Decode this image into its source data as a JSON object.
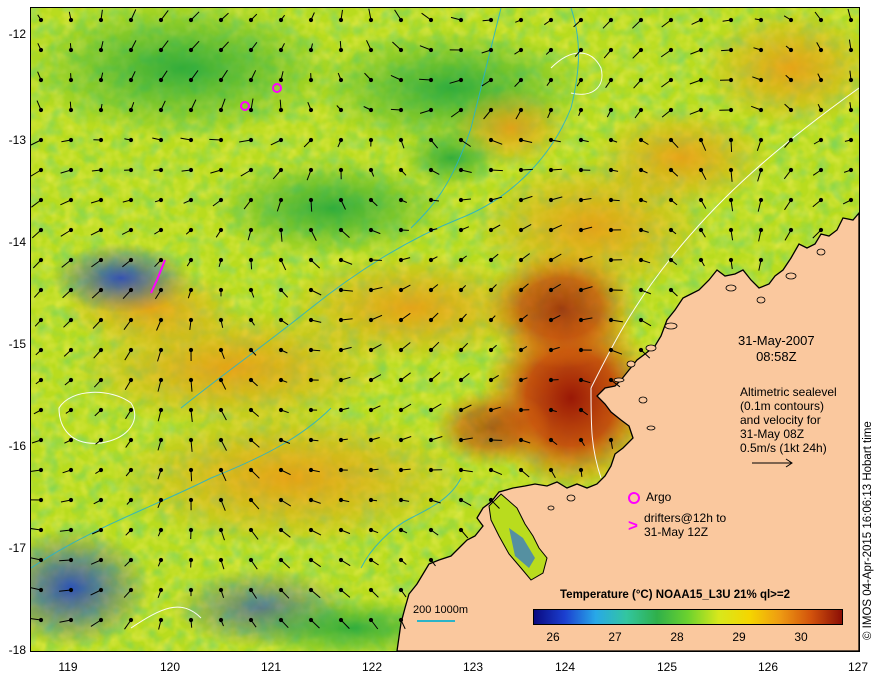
{
  "map": {
    "y_labels": [
      "-12",
      "-13",
      "-14",
      "-15",
      "-16",
      "-17",
      "-18"
    ],
    "x_labels": [
      "119",
      "120",
      "121",
      "122",
      "123",
      "124",
      "125",
      "126",
      "127"
    ],
    "date": "31-May-2007",
    "time": "08:58Z",
    "altimetry_lines": [
      "Altimetric sealevel",
      "(0.1m contours)",
      "and velocity for",
      "31-May 08Z",
      "0.5m/s (1kt 24h)"
    ],
    "argo_label": "Argo",
    "drifters_label_line1": "drifters@12h to",
    "drifters_label_line2": "31-May 12Z",
    "scale_bar_label": "200  1000m",
    "watermark": "© IMOS 04-Apr-2015 16:06:13 Hobart time"
  },
  "colorbar": {
    "title": "Temperature (°C) NOAA15_L3U 21% ql>=2",
    "ticks": [
      "26",
      "27",
      "28",
      "29",
      "30"
    ],
    "range": [
      25.5,
      30.5
    ]
  },
  "colors": {
    "land": "#fac89e",
    "coast": "#000000",
    "contour": "#ffffff",
    "bathymetry": "#2ab3c8",
    "argo": "#ff00ff",
    "drifter": "#ff00ff",
    "warm": "#a01a06",
    "cool": "#1a3cc8"
  }
}
